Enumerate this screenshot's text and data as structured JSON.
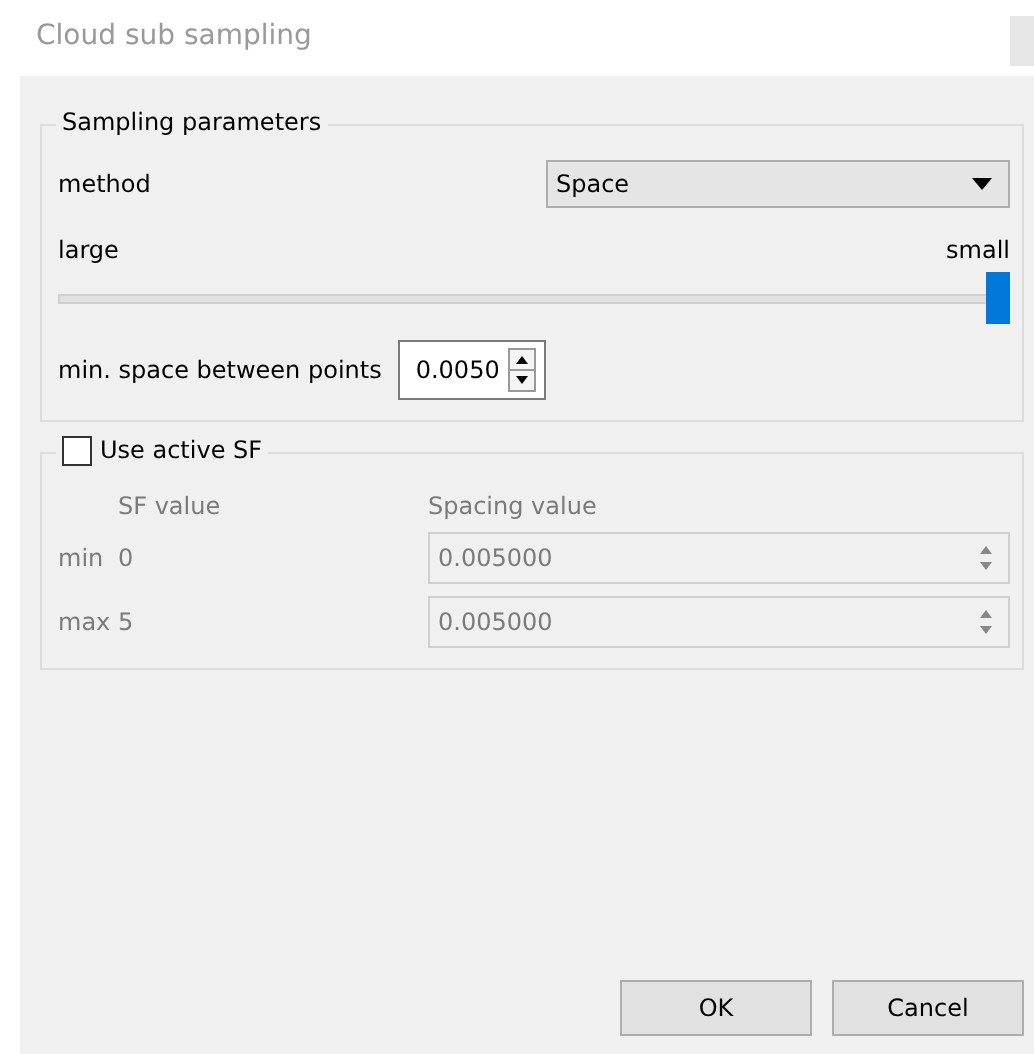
{
  "window": {
    "title": "Cloud sub sampling"
  },
  "sampling": {
    "title": "Sampling parameters",
    "method_label": "method",
    "method_value": "Space",
    "slider_left": "large",
    "slider_right": "small",
    "slider": {
      "level": 1
    },
    "space_label": "min. space between points",
    "space_value": "0.0050"
  },
  "sf": {
    "label": "Use active SF",
    "checked": false,
    "disabled": true,
    "col_sf": "SF value",
    "col_spacing": "Spacing value",
    "rows": [
      {
        "label": "min",
        "sf": "0",
        "spacing": "0.005000"
      },
      {
        "label": "max",
        "sf": "5",
        "spacing": "0.005000"
      }
    ]
  },
  "buttons": [
    "OK",
    "Cancel"
  ]
}
